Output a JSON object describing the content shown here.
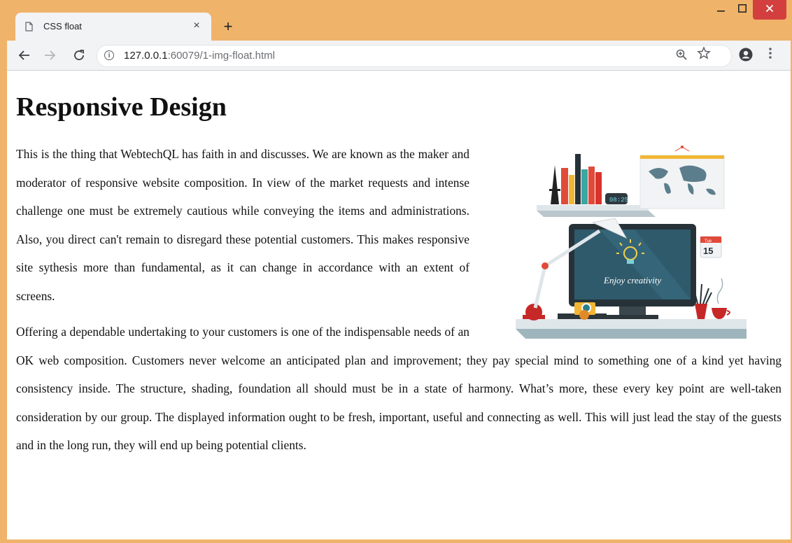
{
  "browser": {
    "tab_title": "CSS float",
    "url_host": "127.0.0.1",
    "url_path": ":60079/1-img-float.html",
    "new_tab_symbol": "+",
    "close_tab_symbol": "×"
  },
  "page": {
    "heading": "Responsive Design",
    "paragraph1": "This is the thing that WebtechQL has faith in and discusses. We are known as the maker and moderator of responsive website composition. In view of the market requests and intense challenge one must be extremely cautious while conveying the items and administrations. Also, you direct can't remain to disregard these potential customers. This makes responsive site sythesis more than fundamental, as it can change in accordance with an extent of screens.",
    "paragraph2": "Offering a dependable undertaking to your customers is one of the indispensable needs of an OK web composition. Customers never welcome an anticipated plan and improvement; they pay special mind to something one of a kind yet having consistency inside. The structure, shading, foundation all should must be in a state of harmony. What’s more, these every key point are well-taken consideration by our group. The displayed information ought to be fresh, important, useful and connecting as well. This will just lead the stay of the guests and in the long run, they will end up being potential clients.",
    "illustration": {
      "screen_text": "Enjoy creativity",
      "calendar_day": "Tue",
      "calendar_date": "15",
      "clock_text": "08:25"
    }
  },
  "colors": {
    "window_frame": "#efb36a",
    "close_button": "#d33f3f"
  }
}
